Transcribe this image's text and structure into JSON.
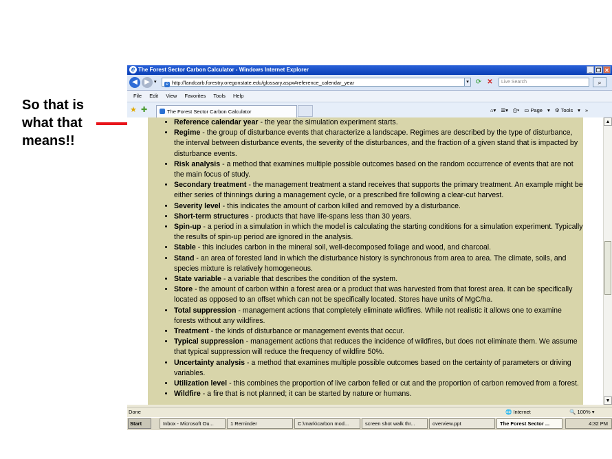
{
  "annotation": {
    "text": "So that is what that means!!",
    "arrow_color": "#e8141b"
  },
  "window": {
    "title": "The Forest Sector Carbon Calculator - Windows Internet Explorer",
    "title_bar_color": "#1a52c8",
    "buttons": {
      "minimize": "_",
      "restore": "❐",
      "close": "✕"
    }
  },
  "address_bar": {
    "url": "http://landcarb.forestry.oregonstate.edu/glossary.aspx#reference_calendar_year",
    "search_placeholder": "Live Search"
  },
  "menu": [
    "File",
    "Edit",
    "View",
    "Favorites",
    "Tools",
    "Help"
  ],
  "tab": {
    "label": "The Forest Sector Carbon Calculator"
  },
  "command_bar": {
    "page": "Page",
    "tools": "Tools"
  },
  "glossary": {
    "background": "#d8d5aa",
    "entries": [
      {
        "term": "Reference calendar year",
        "def": " - the year the simulation experiment starts."
      },
      {
        "term": "Regime",
        "def": " - the group of disturbance events that characterize a landscape. Regimes are described by the type of disturbance, the interval between disturbance events, the severity of the disturbances, and the fraction of a given stand that is impacted by disturbance events."
      },
      {
        "term": "Risk analysis",
        "def": " - a method that examines multiple possible outcomes based on the random occurrence of events that are not the main focus of study."
      },
      {
        "term": "Secondary treatment",
        "def": " - the management treatment a stand receives that supports the primary treatment. An example might be either series of thinnings during a management cycle, or a prescribed fire following a clear-cut harvest."
      },
      {
        "term": "Severity level",
        "def": " - this indicates the amount of carbon killed and removed by a disturbance."
      },
      {
        "term": "Short-term structures",
        "def": " - products that have life-spans less than 30 years."
      },
      {
        "term": "Spin-up",
        "def": " - a period in a simulation in which the model is calculating the starting conditions for a simulation experiment. Typically the results of spin-up period are ignored in the analysis."
      },
      {
        "term": "Stable",
        "def": " - this includes carbon in the mineral soil, well-decomposed foliage and wood, and charcoal."
      },
      {
        "term": "Stand",
        "def": " - an area of forested land in which the disturbance history is synchronous from area to area. The climate, soils, and species mixture is relatively homogeneous."
      },
      {
        "term": "State variable",
        "def": " - a variable that describes the condition of the system."
      },
      {
        "term": "Store",
        "def": " - the amount of carbon within a forest area or a product that was harvested from that forest area. It can be specifically located as opposed to an offset which can not be specifically located. Stores have units of MgC/ha."
      },
      {
        "term": "Total suppression",
        "def": " - management actions that completely eliminate wildfires. While not realistic it allows one to examine forests without any wildfires."
      },
      {
        "term": "Treatment",
        "def": " - the kinds of disturbance or management events that occur."
      },
      {
        "term": "Typical suppression",
        "def": " - management actions that reduces the incidence of wildfires, but does not eliminate them. We assume that typical suppression will reduce the frequency of wildfire 50%."
      },
      {
        "term": "Uncertainty analysis",
        "def": " - a method that examines multiple possible outcomes based on the certainty of parameters or driving variables."
      },
      {
        "term": "Utilization level",
        "def": " - this combines the proportion of live carbon felled or cut and the proportion of carbon removed from a forest."
      },
      {
        "term": "Wildfire",
        "def": " - a fire that is not planned; it can be started by nature or humans."
      }
    ]
  },
  "status_bar": {
    "status": "Done",
    "zone": "Internet",
    "zoom": "100%"
  },
  "taskbar": {
    "start": "Start",
    "items": [
      "Inbox - Microsoft Ou...",
      "1 Reminder",
      "C:\\mark\\carbon mod...",
      "screen shot walk thr...",
      "overview.ppt",
      "The Forest Sector ..."
    ],
    "clock": "4:32 PM"
  }
}
